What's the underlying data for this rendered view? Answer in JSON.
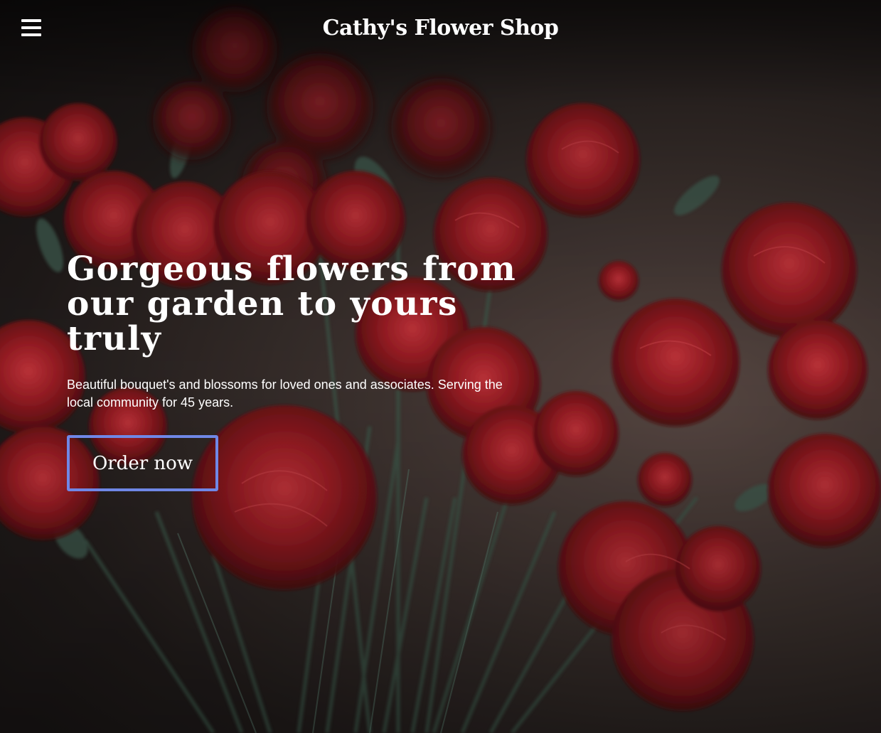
{
  "header": {
    "site_title": "Cathy's Flower Shop",
    "menu_icon": "hamburger-menu-icon"
  },
  "hero": {
    "headline": "Gorgeous flowers from our garden to yours truly",
    "subtext": "Beautiful bouquet's and blossoms for loved ones and associates. Serving the local community for 45 years.",
    "cta_label": "Order now",
    "background_image": "red carnations bouquet photo"
  },
  "colors": {
    "button_border": "#6f87e6",
    "text": "#ffffff",
    "flower_red": "#8e1a1f"
  }
}
